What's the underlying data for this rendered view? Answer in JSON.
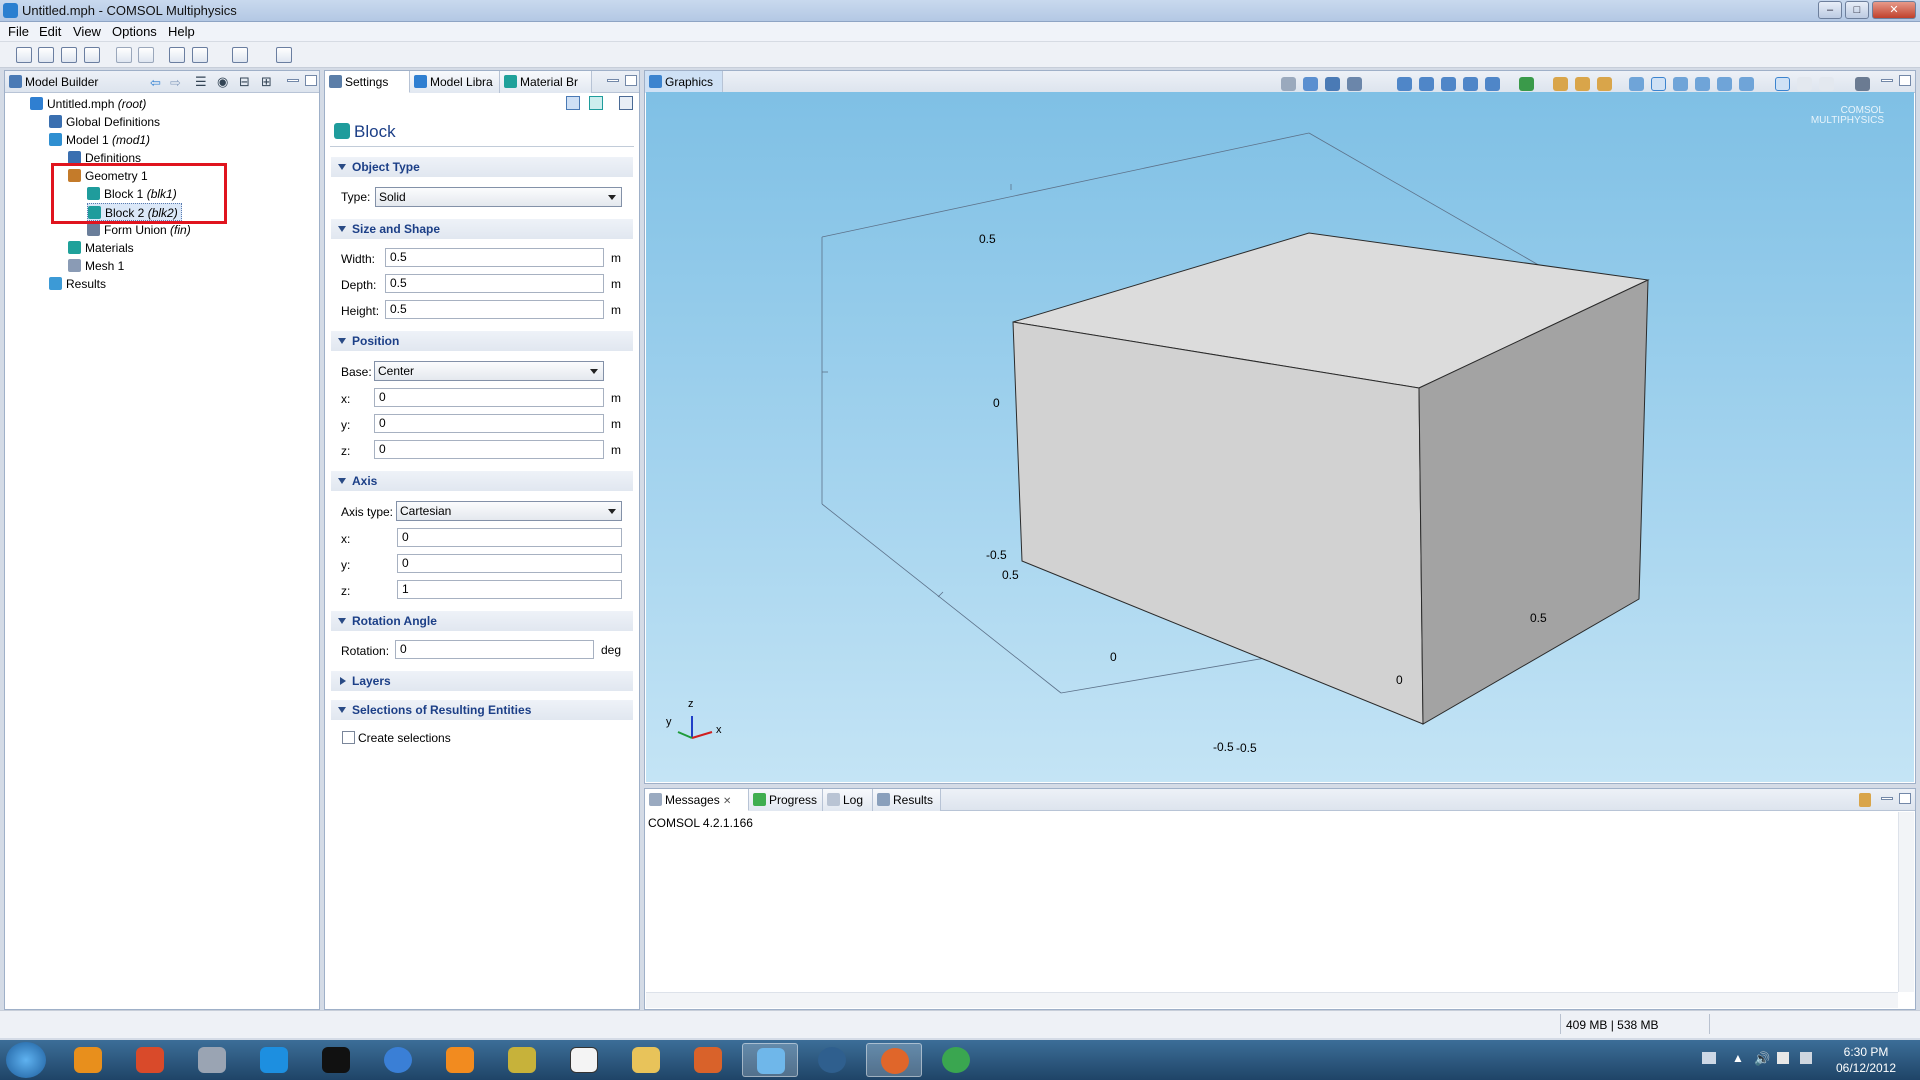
{
  "window": {
    "title": "Untitled.mph - COMSOL Multiphysics"
  },
  "menu": [
    "File",
    "Edit",
    "View",
    "Options",
    "Help"
  ],
  "model_builder": {
    "tab": "Model Builder",
    "tree": [
      {
        "label": "Untitled.mph",
        "tag": "(root)",
        "icon": "mph-file-icon",
        "color": "#2f7fd1"
      },
      {
        "label": "Global Definitions",
        "tag": "",
        "icon": "global-definitions-icon",
        "color": "#3a6fb0"
      },
      {
        "label": "Model 1",
        "tag": "(mod1)",
        "icon": "model-icon",
        "color": "#2f8fd1"
      },
      {
        "label": "Definitions",
        "tag": "",
        "icon": "definitions-icon",
        "color": "#3a6fb0"
      },
      {
        "label": "Geometry 1",
        "tag": "",
        "icon": "geometry-icon",
        "color": "#c47b2a"
      },
      {
        "label": "Block 1",
        "tag": "(blk1)",
        "icon": "block-icon",
        "color": "#1f9c9c"
      },
      {
        "label": "Block 2",
        "tag": "(blk2)",
        "icon": "block-icon",
        "color": "#1f9c9c"
      },
      {
        "label": "Form Union",
        "tag": "(fin)",
        "icon": "form-union-icon",
        "color": "#6a7e9a"
      },
      {
        "label": "Materials",
        "tag": "",
        "icon": "materials-icon",
        "color": "#1fa19a"
      },
      {
        "label": "Mesh 1",
        "tag": "",
        "icon": "mesh-icon",
        "color": "#8a9bb5"
      },
      {
        "label": "Results",
        "tag": "",
        "icon": "results-icon",
        "color": "#3c9ad6"
      }
    ]
  },
  "settings": {
    "tabs": [
      "Settings",
      "Model Libra",
      "Material Br"
    ],
    "title": "Block",
    "sections": {
      "object_type": "Object Type",
      "size_shape": "Size and Shape",
      "position": "Position",
      "axis": "Axis",
      "rotation": "Rotation Angle",
      "layers": "Layers",
      "selections": "Selections of Resulting Entities"
    },
    "type_label": "Type:",
    "type_value": "Solid",
    "width_label": "Width:",
    "width_value": "0.5",
    "depth_label": "Depth:",
    "depth_value": "0.5",
    "height_label": "Height:",
    "height_value": "0.5",
    "unit_m": "m",
    "base_label": "Base:",
    "base_value": "Center",
    "pos_x_label": "x:",
    "pos_x": "0",
    "pos_y_label": "y:",
    "pos_y": "0",
    "pos_z_label": "z:",
    "pos_z": "0",
    "axis_type_label": "Axis type:",
    "axis_type_value": "Cartesian",
    "axis_x_label": "x:",
    "axis_x": "0",
    "axis_y_label": "y:",
    "axis_y": "0",
    "axis_z_label": "z:",
    "axis_z": "1",
    "rotation_label": "Rotation:",
    "rotation_value": "0",
    "unit_deg": "deg",
    "create_selections": "Create selections"
  },
  "graphics": {
    "tab": "Graphics",
    "logo_line1": "COMSOL",
    "logo_line2": "MULTIPHYSICS",
    "ticks": {
      "z_top": "0.5",
      "z_mid": "0",
      "z_bottom": "-0.5",
      "y_left": "0.5",
      "y_mid": "0",
      "y_right": "-0.5",
      "x_left": "-0.5",
      "x_mid": "0",
      "x_right": "0.5"
    },
    "triad": {
      "x": "x",
      "y": "y",
      "z": "z"
    }
  },
  "messages": {
    "tabs": [
      "Messages",
      "Progress",
      "Log",
      "Results"
    ],
    "text": "COMSOL 4.2.1.166"
  },
  "status": {
    "memory": "409 MB | 538 MB"
  },
  "taskbar": {
    "apps": [
      "windows-start-icon",
      "app-icon",
      "app-icon",
      "app-icon",
      "teamviewer-icon",
      "command-prompt-icon",
      "itunes-icon",
      "media-player-icon",
      "app-icon",
      "vnc-icon",
      "file-explorer-icon",
      "matlab-icon",
      "comsol-icon",
      "app-icon",
      "firefox-icon",
      "chrome-icon"
    ],
    "time": "6:30 PM",
    "date": "06/12/2012"
  }
}
